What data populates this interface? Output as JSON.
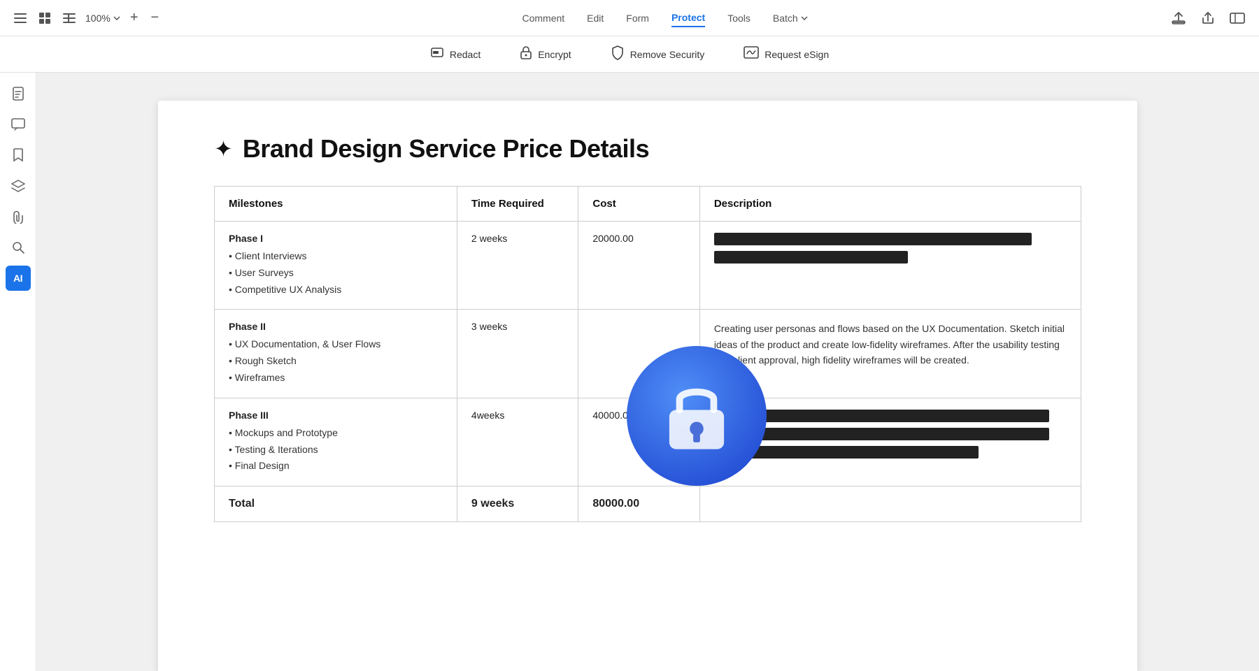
{
  "topbar": {
    "zoom": "100%",
    "nav_items": [
      "Comment",
      "Edit",
      "Form",
      "Protect",
      "Tools",
      "Batch"
    ],
    "active_nav": "Protect"
  },
  "toolbar": {
    "items": [
      {
        "id": "redact",
        "label": "Redact",
        "icon": "redact"
      },
      {
        "id": "encrypt",
        "label": "Encrypt",
        "icon": "lock"
      },
      {
        "id": "remove-security",
        "label": "Remove Security",
        "icon": "shield"
      },
      {
        "id": "request-esign",
        "label": "Request eSign",
        "icon": "esign"
      }
    ]
  },
  "sidebar": {
    "items": [
      {
        "id": "page",
        "icon": "page"
      },
      {
        "id": "comment",
        "icon": "comment"
      },
      {
        "id": "bookmark",
        "icon": "bookmark"
      },
      {
        "id": "layers",
        "icon": "layers"
      },
      {
        "id": "attachment",
        "icon": "attachment"
      },
      {
        "id": "search",
        "icon": "search"
      },
      {
        "id": "ai",
        "icon": "ai",
        "active": true
      }
    ]
  },
  "document": {
    "title": "Brand Design Service Price Details",
    "table": {
      "headers": [
        "Milestones",
        "Time Required",
        "Cost",
        "Description"
      ],
      "rows": [
        {
          "phase": "Phase I",
          "items": [
            "• Client Interviews",
            "• User Surveys",
            "• Competitive UX Analysis"
          ],
          "time": "2 weeks",
          "cost": "20000.00",
          "description_redacted": true,
          "redacted_bars": [
            90,
            55
          ]
        },
        {
          "phase": "Phase II",
          "items": [
            "• UX Documentation, & User Flows",
            "• Rough Sketch",
            "• Wireframes"
          ],
          "time": "3 weeks",
          "cost": "",
          "description_text": "Creating user personas and flows based on the UX Documentation. Sketch initial ideas of the product and create low-fidelity wireframes. After the usability testing and client approval, high fidelity wireframes will be created.",
          "description_redacted": false
        },
        {
          "phase": "Phase III",
          "items": [
            "• Mockups and Prototype",
            "• Testing & Iterations",
            "• Final Design"
          ],
          "time": "4weeks",
          "cost": "40000.00",
          "description_redacted": true,
          "redacted_bars": [
            95,
            95,
            75
          ]
        }
      ],
      "total": {
        "label": "Total",
        "time": "9 weeks",
        "cost": "80000.00"
      }
    }
  }
}
